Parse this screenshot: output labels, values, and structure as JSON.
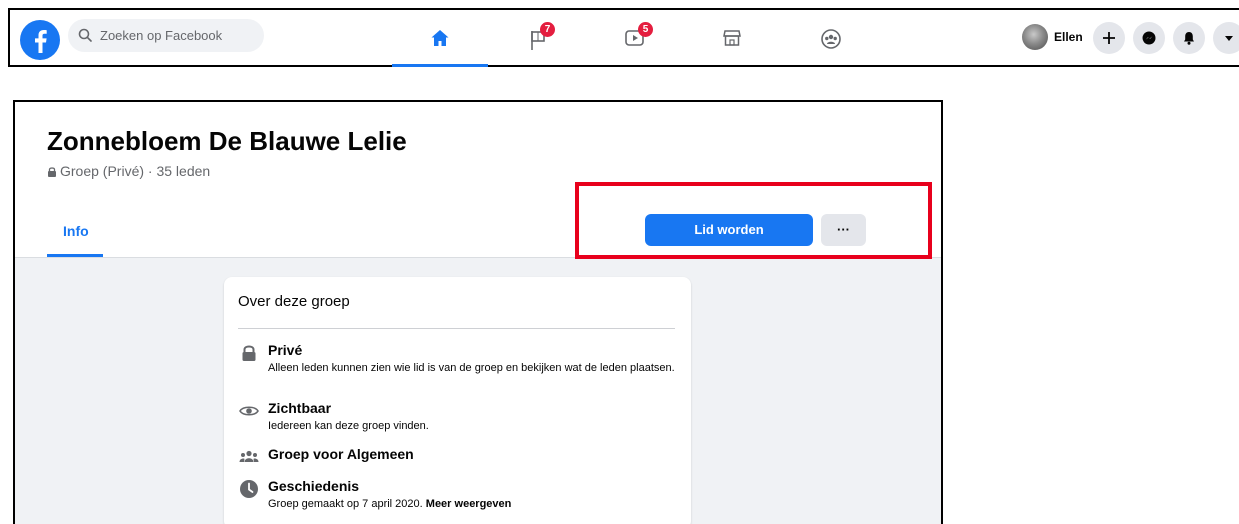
{
  "topbar": {
    "search_placeholder": "Zoeken op Facebook",
    "tabs": [
      {
        "name": "home",
        "badge": ""
      },
      {
        "name": "pages",
        "badge": "7"
      },
      {
        "name": "watch",
        "badge": "5"
      },
      {
        "name": "marketplace",
        "badge": ""
      },
      {
        "name": "groups",
        "badge": ""
      }
    ],
    "profile_name": "Ellen",
    "icons": [
      "facebook-logo-icon",
      "search-icon",
      "home-icon",
      "flag-icon",
      "video-icon",
      "store-icon",
      "groups-icon",
      "plus-icon",
      "messenger-icon",
      "bell-icon",
      "caret-down-icon"
    ]
  },
  "group": {
    "name": "Zonnebloem De Blauwe Lelie",
    "meta": "Groep (Privé) · 35 leden",
    "tab_info": "Info",
    "join_label": "Lid worden",
    "more_label": "···"
  },
  "about": {
    "title": "Over deze groep",
    "rows": [
      {
        "icon": "lock-icon",
        "title": "Privé",
        "desc": "Alleen leden kunnen zien wie lid is van de groep en bekijken wat de leden plaatsen."
      },
      {
        "icon": "eye-icon",
        "title": "Zichtbaar",
        "desc": "Iedereen kan deze groep vinden."
      },
      {
        "icon": "people-icon",
        "title": "Groep voor Algemeen",
        "desc": ""
      },
      {
        "icon": "clock-icon",
        "title": "Geschiedenis",
        "desc": "Groep gemaakt op 7 april 2020.",
        "link": "Meer weergeven"
      }
    ]
  },
  "colors": {
    "brand_blue": "#1877f2",
    "badge_red": "#e41e3f",
    "highlight_red": "#e8001c",
    "page_bg": "#f0f2f5"
  }
}
